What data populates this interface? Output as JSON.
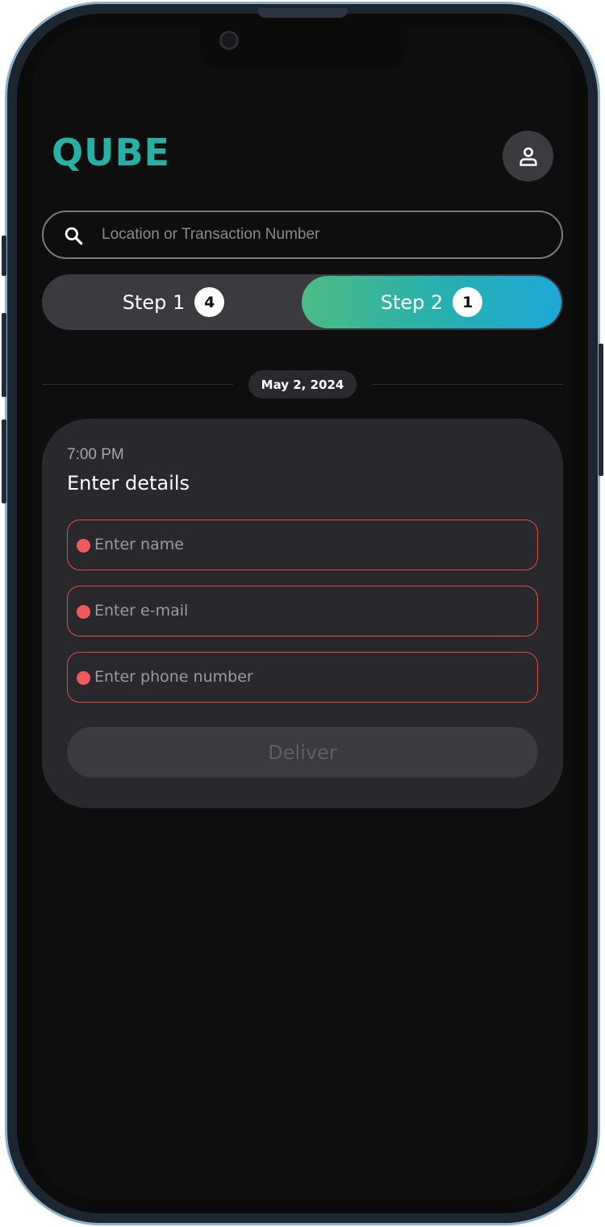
{
  "header": {
    "logo_text": "QUBE",
    "profile_icon": "person-icon"
  },
  "search": {
    "placeholder": "Location or Transaction Number",
    "value": "",
    "icon": "search-icon"
  },
  "steps": [
    {
      "label": "Step 1",
      "count": "4",
      "active": false
    },
    {
      "label": "Step 2",
      "count": "1",
      "active": true
    }
  ],
  "date_separator": "May 2, 2024",
  "card": {
    "time": "7:00 PM",
    "title": "Enter details",
    "fields": [
      {
        "placeholder": "Enter name",
        "value": "",
        "required": true
      },
      {
        "placeholder": "Enter e-mail",
        "value": "",
        "required": true
      },
      {
        "placeholder": "Enter phone number",
        "value": "",
        "required": true
      }
    ],
    "submit_label": "Deliver",
    "submit_enabled": false
  },
  "colors": {
    "brand": "#27b0a4",
    "active_gradient_start": "#4cbb84",
    "active_gradient_end": "#1fa8d8",
    "error": "#f05a5a"
  }
}
